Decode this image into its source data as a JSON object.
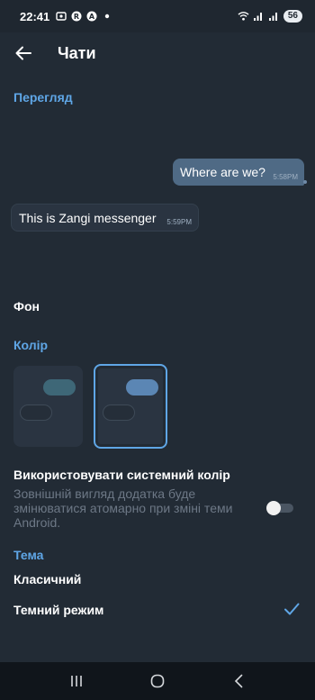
{
  "status_bar": {
    "time": "22:41",
    "battery": "56",
    "left_icons": [
      "screen-record-icon",
      "r-app-icon",
      "a-app-icon",
      "dot-icon"
    ],
    "right_icons": [
      "wifi-icon",
      "signal-icon",
      "signal-icon"
    ]
  },
  "app_bar": {
    "title": "Чати"
  },
  "preview": {
    "header": "Перегляд",
    "outgoing": {
      "text": "Where are we?",
      "time": "5:58PM"
    },
    "incoming": {
      "text": "This is Zangi messenger",
      "time": "5:59PM"
    }
  },
  "background_label": "Фон",
  "color": {
    "header": "Колір",
    "swatches": [
      {
        "accent": "#3e6777",
        "selected": false
      },
      {
        "accent": "#5b86b4",
        "selected": true
      }
    ]
  },
  "system_color": {
    "title": "Використовувати системний колір",
    "description": "Зовнішній вигляд додатка буде змінюватися атомарно при зміні теми Android.",
    "enabled": false
  },
  "theme": {
    "header": "Тема",
    "options": [
      {
        "label": "Класичний",
        "selected": false
      },
      {
        "label": "Темний режим",
        "selected": true
      }
    ]
  },
  "colors": {
    "background": "#222b35",
    "accent": "#5fa6e6",
    "outgoing_bubble": "#4f6a85"
  }
}
